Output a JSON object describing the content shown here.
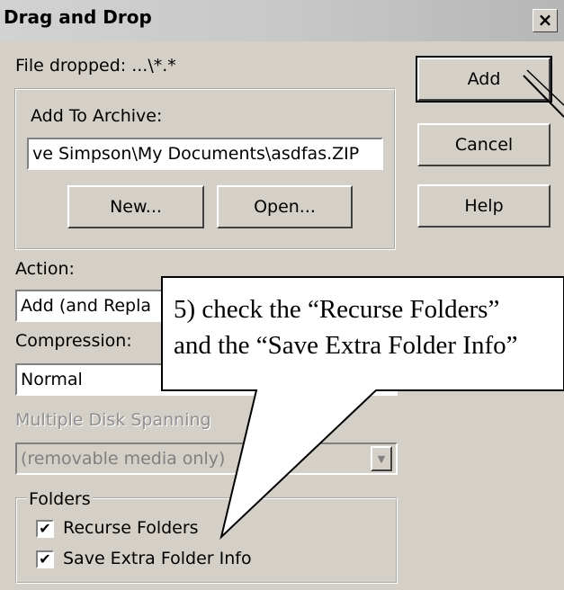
{
  "window": {
    "title": "Drag and Drop",
    "close_glyph": "×"
  },
  "file_dropped": "File dropped: ...\\*.*",
  "archive": {
    "group_label": "Add To Archive:",
    "path_value": "ve Simpson\\My Documents\\asdfas.ZIP",
    "new_label": "New...",
    "open_label": "Open..."
  },
  "buttons": {
    "add": "Add",
    "cancel": "Cancel",
    "help": "Help"
  },
  "action": {
    "label": "Action:",
    "value": "Add (and Repla"
  },
  "compression": {
    "label": "Compression:",
    "value": "Normal"
  },
  "spanning": {
    "label": "Multiple Disk Spanning",
    "value": "(removable media only)"
  },
  "folders": {
    "group_label": "Folders",
    "recurse_label": "Recurse Folders",
    "recurse_checked": true,
    "save_extra_label": "Save Extra Folder Info",
    "save_extra_checked": true
  },
  "callout": {
    "line1": "5) check the “Recurse Folders”",
    "line2": "and the “Save Extra Folder Info”"
  },
  "colors": {
    "dialog_bg": "#d4d0c8",
    "callout_bg": "#ffffff"
  }
}
